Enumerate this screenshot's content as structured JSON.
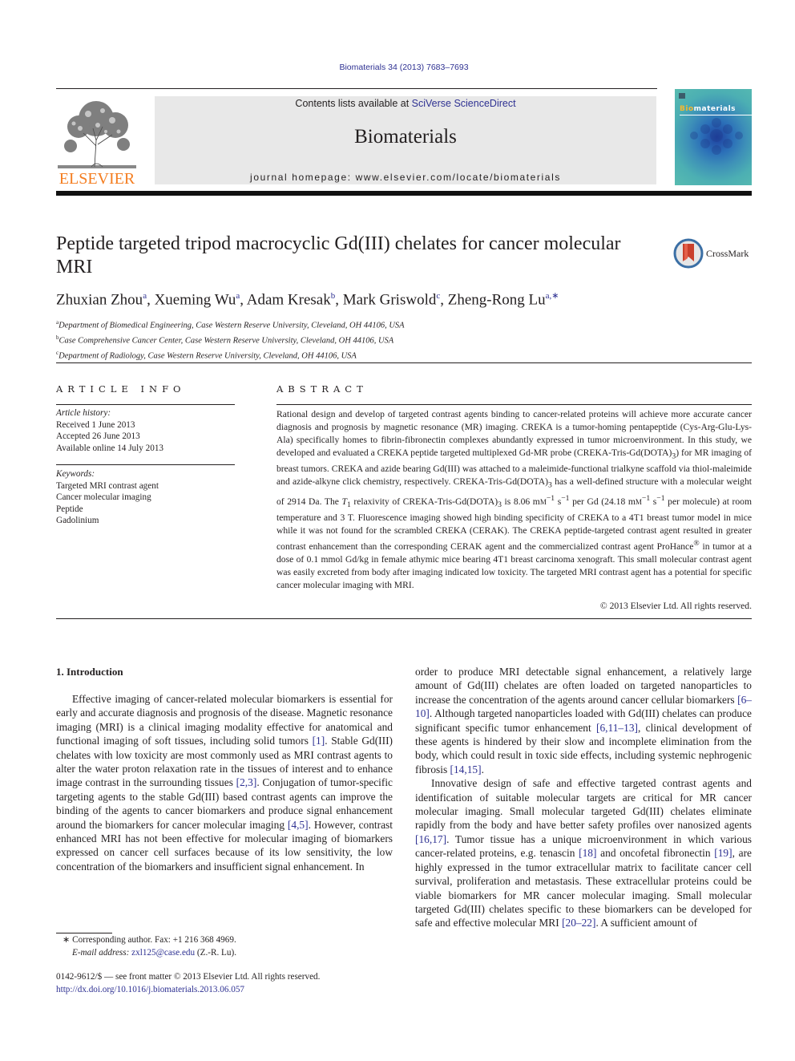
{
  "header": {
    "citation": "Biomaterials 34 (2013) 7683–7693",
    "contents_prefix": "Contents lists available at ",
    "contents_link": "SciVerse ScienceDirect",
    "journal_name": "Biomaterials",
    "homepage_prefix": "journal homepage: ",
    "homepage_url": "www.elsevier.com/locate/biomaterials",
    "publisher_logo_text": "ELSEVIER",
    "cover_title_highlight": "Bio",
    "cover_title_rest": "materials",
    "colors": {
      "link": "#2e3192",
      "elsevier_orange": "#f47d20",
      "masthead_bg": "#e8e8e8"
    }
  },
  "article": {
    "title": "Peptide targeted tripod macrocyclic Gd(III) chelates for cancer molecular MRI",
    "crossmark_label": "CrossMark",
    "authors": [
      {
        "name": "Zhuxian Zhou",
        "aff": "a"
      },
      {
        "name": "Xueming Wu",
        "aff": "a"
      },
      {
        "name": "Adam Kresak",
        "aff": "b"
      },
      {
        "name": "Mark Griswold",
        "aff": "c"
      },
      {
        "name": "Zheng-Rong Lu",
        "aff": "a,∗"
      }
    ],
    "affiliations": [
      {
        "key": "a",
        "text": "Department of Biomedical Engineering, Case Western Reserve University, Cleveland, OH 44106, USA"
      },
      {
        "key": "b",
        "text": "Case Comprehensive Cancer Center, Case Western Reserve University, Cleveland, OH 44106, USA"
      },
      {
        "key": "c",
        "text": "Department of Radiology, Case Western Reserve University, Cleveland, OH 44106, USA"
      }
    ]
  },
  "article_info": {
    "heading": "ARTICLE INFO",
    "history_label": "Article history:",
    "history": [
      "Received 1 June 2013",
      "Accepted 26 June 2013",
      "Available online 14 July 2013"
    ],
    "keywords_label": "Keywords:",
    "keywords": [
      "Targeted MRI contrast agent",
      "Cancer molecular imaging",
      "Peptide",
      "Gadolinium"
    ]
  },
  "abstract": {
    "heading": "ABSTRACT",
    "text_1": "Rational design and develop of targeted contrast agents binding to cancer-related proteins will achieve more accurate cancer diagnosis and prognosis by magnetic resonance (MR) imaging. CREKA is a tumor-homing pentapeptide (Cys-Arg-Glu-Lys-Ala) specifically homes to fibrin-fibronectin complexes abundantly expressed in tumor microenvironment. In this study, we developed and evaluated a CREKA peptide targeted multiplexed Gd-MR probe (CREKA-Tris-Gd(DOTA)",
    "text_2": ") for MR imaging of breast tumors. CREKA and azide bearing Gd(III) was attached to a maleimide-functional trialkyne scaffold via thiol-maleimide and azide-alkyne click chemistry, respectively. CREKA-Tris-Gd(DOTA)",
    "text_3": " has a well-defined structure with a molecular weight of 2914 Da. The ",
    "text_4": " relaxivity of CREKA-Tris-Gd(DOTA)",
    "text_5": " is 8.06 m",
    "text_6": " per Gd (24.18 m",
    "text_7": " per molecule) at room temperature and 3 T. Fluorescence imaging showed high binding specificity of CREKA to a 4T1 breast tumor model in mice while it was not found for the scrambled CREKA (CERAK). The CREKA peptide-targeted contrast agent resulted in greater contrast enhancement than the corresponding CERAK agent and the commercialized contrast agent ProHance",
    "text_8": " in tumor at a dose of 0.1 mmol Gd/kg in female athymic mice bearing 4T1 breast carcinoma xenograft. This small molecular contrast agent was easily excreted from body after imaging indicated low toxicity. The targeted MRI contrast agent has a potential for specific cancer molecular imaging with MRI.",
    "sub3": "3",
    "t1": "T",
    "t1_sub": "1",
    "unit_m": "M",
    "unit_sup": "−1",
    "unit_s": " s",
    "reg": "®",
    "copyright": "© 2013 Elsevier Ltd. All rights reserved."
  },
  "introduction": {
    "heading": "1.  Introduction",
    "left_p1_a": "Effective imaging of cancer-related molecular biomarkers is essential for early and accurate diagnosis and prognosis of the disease. Magnetic resonance imaging (MRI) is a clinical imaging modality effective for anatomical and functional imaging of soft tissues, including solid tumors ",
    "left_p1_ref1": "[1]",
    "left_p1_b": ". Stable Gd(III) chelates with low toxicity are most commonly used as MRI contrast agents to alter the water proton relaxation rate in the tissues of interest and to enhance image contrast in the surrounding tissues ",
    "left_p1_ref2": "[2,3]",
    "left_p1_c": ". Conjugation of tumor-specific targeting agents to the stable Gd(III) based contrast agents can improve the binding of the agents to cancer biomarkers and produce signal enhancement around the biomarkers for cancer molecular imaging ",
    "left_p1_ref3": "[4,5]",
    "left_p1_d": ". However, contrast enhanced MRI has not been effective for molecular imaging of biomarkers expressed on cancer cell surfaces because of its low sensitivity, the low concentration of the biomarkers and insufficient signal enhancement. In",
    "right_p1_a": "order to produce MRI detectable signal enhancement, a relatively large amount of Gd(III) chelates are often loaded on targeted nanoparticles to increase the concentration of the agents around cancer cellular biomarkers ",
    "right_p1_ref1": "[6–10]",
    "right_p1_b": ". Although targeted nanoparticles loaded with Gd(III) chelates can produce significant specific tumor enhancement ",
    "right_p1_ref2": "[6,11–13]",
    "right_p1_c": ", clinical development of these agents is hindered by their slow and incomplete elimination from the body, which could result in toxic side effects, including systemic nephrogenic fibrosis ",
    "right_p1_ref3": "[14,15]",
    "right_p1_d": ".",
    "right_p2_a": "Innovative design of safe and effective targeted contrast agents and identification of suitable molecular targets are critical for MR cancer molecular imaging. Small molecular targeted Gd(III) chelates eliminate rapidly from the body and have better safety profiles over nanosized agents ",
    "right_p2_ref1": "[16,17]",
    "right_p2_b": ". Tumor tissue has a unique microenvironment in which various cancer-related proteins, e.g. tenascin ",
    "right_p2_ref2": "[18]",
    "right_p2_c": " and oncofetal fibronectin ",
    "right_p2_ref3": "[19]",
    "right_p2_d": ", are highly expressed in the tumor extracellular matrix to facilitate cancer cell survival, proliferation and metastasis. These extracellular proteins could be viable biomarkers for MR cancer molecular imaging. Small molecular targeted Gd(III) chelates specific to these biomarkers can be developed for safe and effective molecular MRI ",
    "right_p2_ref4": "[20–22]",
    "right_p2_e": ". A sufficient amount of"
  },
  "footnotes": {
    "corresponding": "∗  Corresponding author. Fax: +1 216 368 4969.",
    "email_label": "E-mail address: ",
    "email": "zxl125@case.edu",
    "email_suffix": " (Z.-R. Lu).",
    "issn": "0142-9612/$ — see front matter © 2013 Elsevier Ltd. All rights reserved.",
    "doi": "http://dx.doi.org/10.1016/j.biomaterials.2013.06.057"
  }
}
